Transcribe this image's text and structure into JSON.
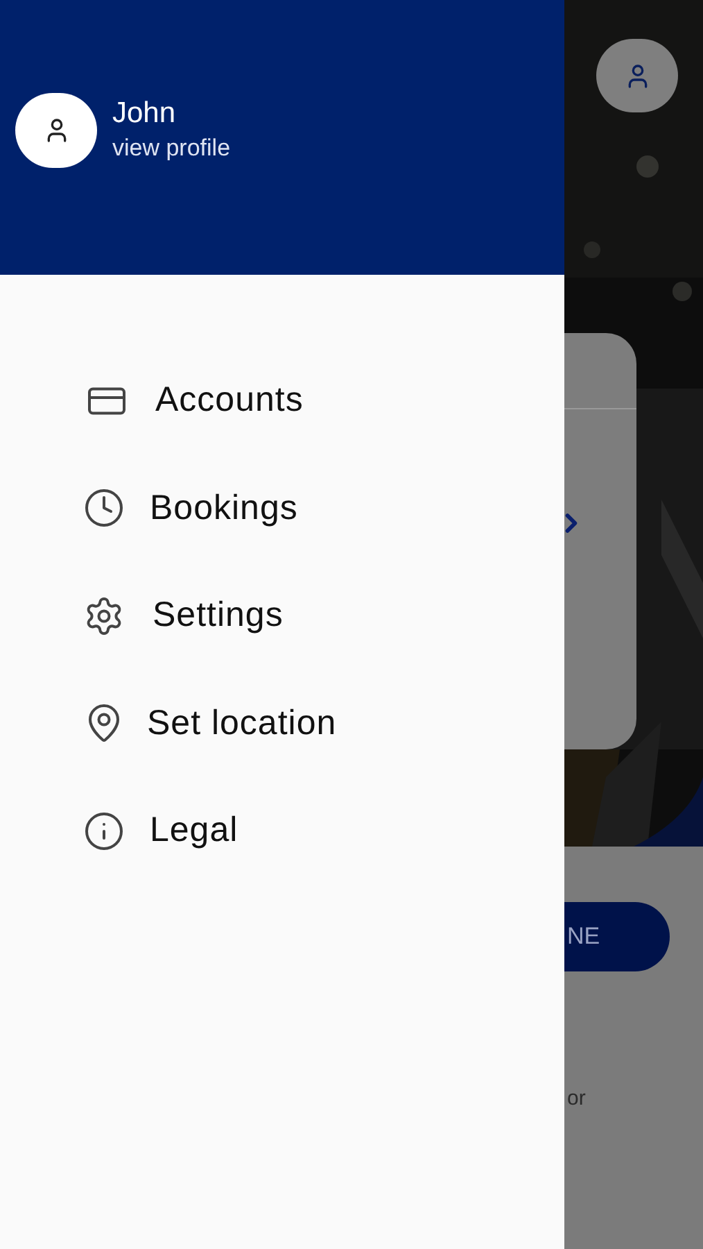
{
  "drawer": {
    "user": {
      "name": "John",
      "link": "view profile"
    },
    "menu": [
      {
        "label": "Accounts"
      },
      {
        "label": "Bookings"
      },
      {
        "label": "Settings"
      },
      {
        "label": "Set location"
      },
      {
        "label": "Legal"
      }
    ]
  },
  "background": {
    "button": "NE",
    "text": "or"
  }
}
